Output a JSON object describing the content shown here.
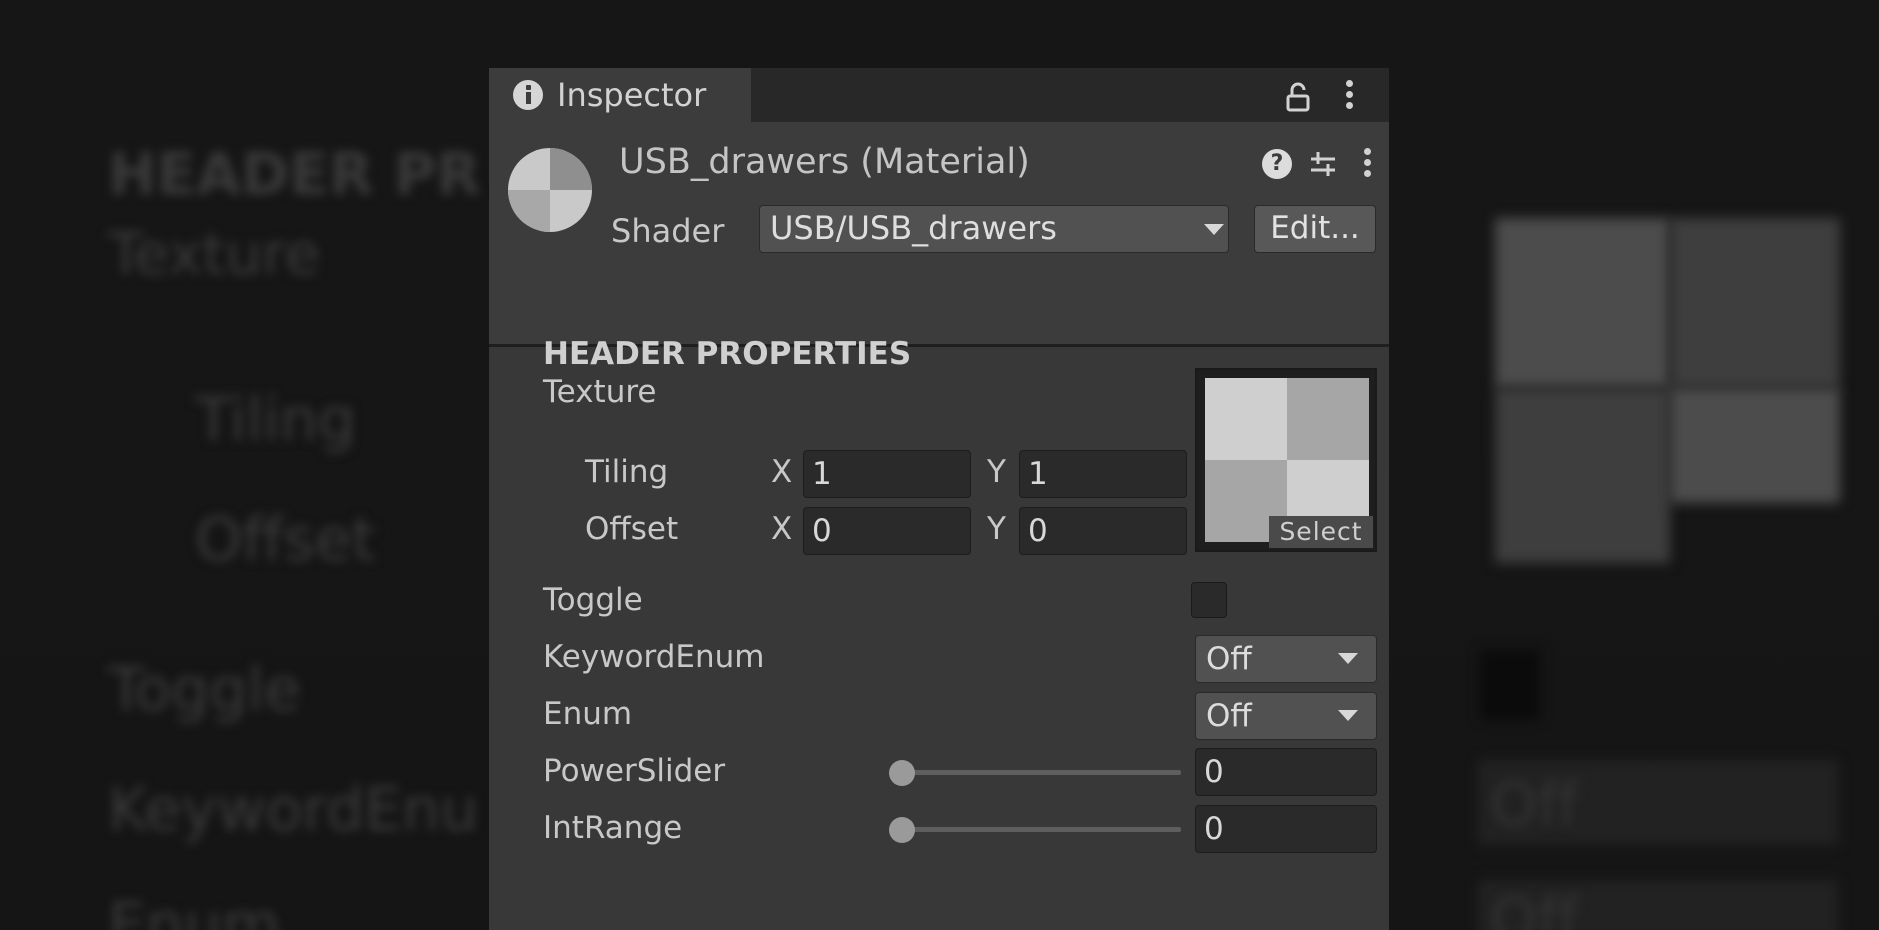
{
  "background_echo": {
    "section_title": "HEADER PR",
    "texture_label": "Texture",
    "tiling_label": "Tiling",
    "offset_label": "Offset",
    "toggle_label": "Toggle",
    "keywordenum_label": "KeywordEnu",
    "enum_label": "Enum",
    "dropdown_value_1": "Off",
    "dropdown_value_2": "Off"
  },
  "window": {
    "tab_label": "Inspector",
    "icons": [
      "info-icon",
      "lock-icon",
      "kebab-icon"
    ]
  },
  "material": {
    "title": "USB_drawers (Material)",
    "shader_label": "Shader",
    "shader_value": "USB/USB_drawers",
    "edit_button": "Edit...",
    "icons": [
      "help-icon",
      "preset-icon",
      "kebab-icon"
    ]
  },
  "properties": {
    "section_title": "HEADER PROPERTIES",
    "texture": {
      "label": "Texture",
      "tiling_label": "Tiling",
      "offset_label": "Offset",
      "x_label": "X",
      "y_label": "Y",
      "tiling_x": "1",
      "tiling_y": "1",
      "offset_x": "0",
      "offset_y": "0",
      "select_label": "Select"
    },
    "toggle": {
      "label": "Toggle",
      "checked": false
    },
    "keyword_enum": {
      "label": "KeywordEnum",
      "value": "Off"
    },
    "enum": {
      "label": "Enum",
      "value": "Off"
    },
    "power_slider": {
      "label": "PowerSlider",
      "value": "0",
      "fraction": 0
    },
    "int_range": {
      "label": "IntRange",
      "value": "0",
      "fraction": 0
    }
  },
  "colors": {
    "panel": "#383838",
    "tabbar": "#282828",
    "field": "#2a2a2a",
    "text": "#c8c8c8"
  }
}
